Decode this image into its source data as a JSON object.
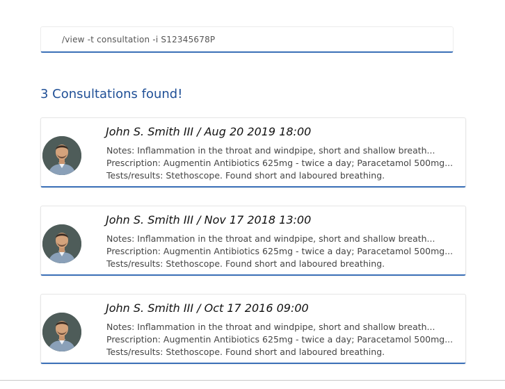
{
  "command": {
    "value": "/view -t consultation -i S12345678P"
  },
  "results": {
    "heading": "3 Consultations found!"
  },
  "consultations": [
    {
      "title": "John S. Smith III / Aug 20 2019 18:00",
      "notes": "Notes: Inflammation in the throat and windpipe, short and shallow breath...",
      "prescription": "Prescription: Augmentin Antibiotics 625mg - twice a day; Paracetamol 500mg...",
      "tests": "Tests/results: Stethoscope. Found short and laboured breathing.",
      "avatar_icon": "person-avatar-icon"
    },
    {
      "title": "John S. Smith III / Nov 17 2018 13:00",
      "notes": "Notes: Inflammation in the throat and windpipe, short and shallow breath...",
      "prescription": "Prescription: Augmentin Antibiotics 625mg - twice a day; Paracetamol 500mg...",
      "tests": "Tests/results: Stethoscope. Found short and laboured breathing.",
      "avatar_icon": "person-avatar-icon"
    },
    {
      "title": "John S. Smith III / Oct 17 2016 09:00",
      "notes": "Notes: Inflammation in the throat and windpipe, short and shallow breath...",
      "prescription": "Prescription: Augmentin Antibiotics 625mg - twice a day; Paracetamol 500mg...",
      "tests": "Tests/results: Stethoscope. Found short and laboured breathing.",
      "avatar_icon": "person-avatar-icon"
    }
  ],
  "colors": {
    "accent": "#3a6fb7",
    "heading": "#1f4f96"
  }
}
